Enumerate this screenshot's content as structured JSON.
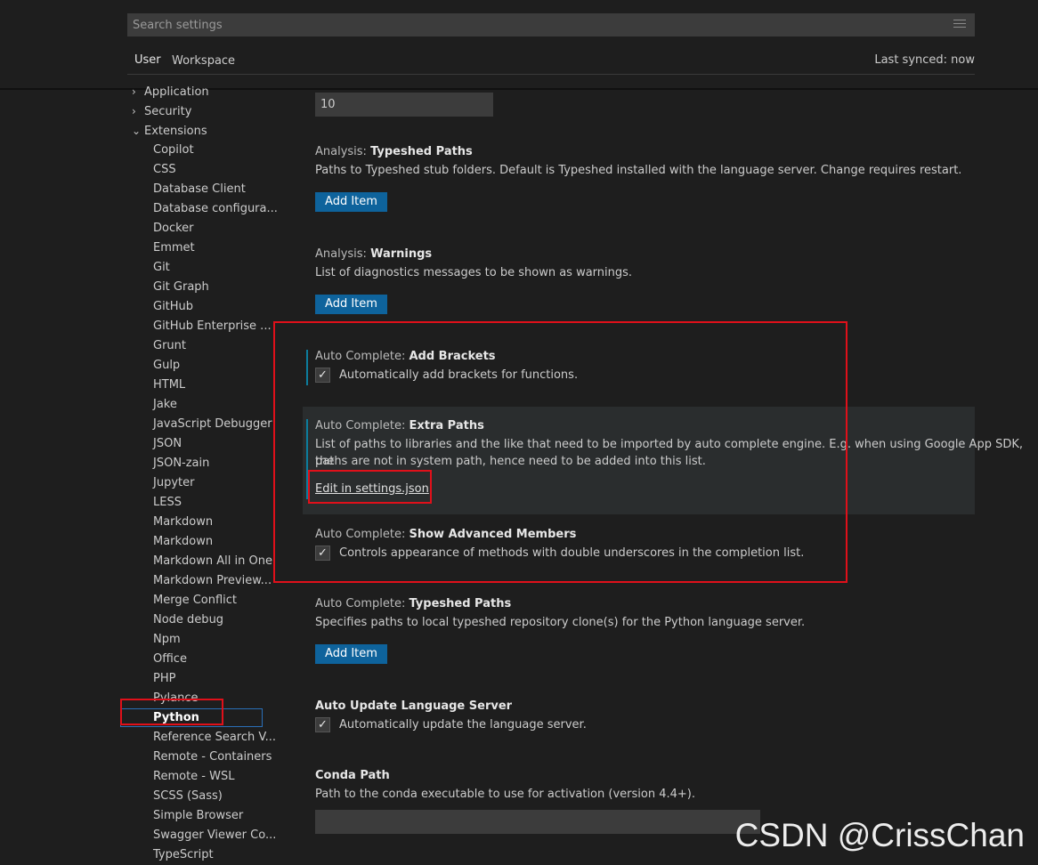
{
  "search": {
    "placeholder": "Search settings"
  },
  "tabs": {
    "user": "User",
    "workspace": "Workspace"
  },
  "sync_status": "Last synced: now",
  "toc": {
    "groups": [
      {
        "label": "Application",
        "chevron": "chevron-right-icon"
      },
      {
        "label": "Security",
        "chevron": "chevron-right-icon"
      },
      {
        "label": "Extensions",
        "chevron": "chevron-down-icon"
      }
    ],
    "extensions": [
      "Copilot",
      "CSS",
      "Database Client",
      "Database configura...",
      "Docker",
      "Emmet",
      "Git",
      "Git Graph",
      "GitHub",
      "GitHub Enterprise ...",
      "Grunt",
      "Gulp",
      "HTML",
      "Jake",
      "JavaScript Debugger",
      "JSON",
      "JSON-zain",
      "Jupyter",
      "LESS",
      "Markdown",
      "Markdown",
      "Markdown All in One",
      "Markdown Preview...",
      "Merge Conflict",
      "Node debug",
      "Npm",
      "Office",
      "PHP",
      "Pylance",
      "Python",
      "Reference Search V...",
      "Remote - Containers",
      "Remote - WSL",
      "SCSS (Sass)",
      "Simple Browser",
      "Swagger Viewer Co...",
      "TypeScript"
    ],
    "selected": "Python"
  },
  "settings": {
    "top_value": "10",
    "typeshed_paths": {
      "category": "Analysis: ",
      "name": "Typeshed Paths",
      "description": "Paths to Typeshed stub folders. Default is Typeshed installed with the language server. Change requires restart.",
      "button": "Add Item"
    },
    "warnings": {
      "category": "Analysis: ",
      "name": "Warnings",
      "description": "List of diagnostics messages to be shown as warnings.",
      "button": "Add Item"
    },
    "add_brackets": {
      "category": "Auto Complete: ",
      "name": "Add Brackets",
      "checkbox_label": "Automatically add brackets for functions.",
      "checked": true
    },
    "extra_paths": {
      "category": "Auto Complete: ",
      "name": "Extra Paths",
      "description_line1": "List of paths to libraries and the like that need to be imported by auto complete engine. E.g. when using Google App SDK, the",
      "description_line2": "paths are not in system path, hence need to be added into this list.",
      "link": "Edit in settings.json"
    },
    "show_advanced_members": {
      "category": "Auto Complete: ",
      "name": "Show Advanced Members",
      "checkbox_label": "Controls appearance of methods with double underscores in the completion list.",
      "checked": true
    },
    "autocomplete_typeshed": {
      "category": "Auto Complete: ",
      "name": "Typeshed Paths",
      "description": "Specifies paths to local typeshed repository clone(s) for the Python language server.",
      "button": "Add Item"
    },
    "auto_update": {
      "name": "Auto Update Language Server",
      "checkbox_label": "Automatically update the language server.",
      "checked": true
    },
    "conda_path": {
      "name": "Conda Path",
      "description": "Path to the conda executable to use for activation (version 4.4+).",
      "value": ""
    }
  },
  "check_glyph": "✓",
  "watermark": "CSDN @CrissChan",
  "colors": {
    "background": "#1e1e1e",
    "button": "#0e639c",
    "annotation_red": "#e0101a",
    "selection_border": "#2a6fb8",
    "modified_indicator": "#0c7d9d"
  }
}
